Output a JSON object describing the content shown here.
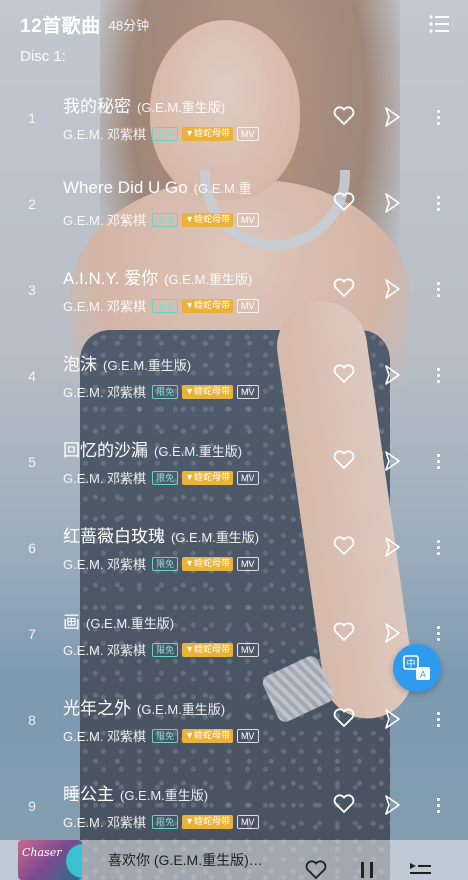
{
  "header": {
    "title": "12首歌曲",
    "duration": "48分钟",
    "menu_icon": "list-menu-icon"
  },
  "disc_label": "Disc 1:",
  "badges": {
    "free": "限免",
    "album": "▼蝰蛇母带",
    "mv": "MV"
  },
  "tracks": [
    {
      "num": "1",
      "name": "我的秘密",
      "version": "(G.E.M.重生版)",
      "artist": "G.E.M. 邓紫棋"
    },
    {
      "num": "2",
      "name": "Where Did U Go",
      "version": "(G.E.M.重",
      "artist": "G.E.M. 邓紫棋"
    },
    {
      "num": "3",
      "name": "A.I.N.Y. 爱你",
      "version": "(G.E.M.重生版)",
      "artist": "G.E.M. 邓紫棋"
    },
    {
      "num": "4",
      "name": "泡沫",
      "version": "(G.E.M.重生版)",
      "artist": "G.E.M. 邓紫棋"
    },
    {
      "num": "5",
      "name": "回忆的沙漏",
      "version": "(G.E.M.重生版)",
      "artist": "G.E.M. 邓紫棋"
    },
    {
      "num": "6",
      "name": "红蔷薇白玫瑰",
      "version": "(G.E.M.重生版)",
      "artist": "G.E.M. 邓紫棋"
    },
    {
      "num": "7",
      "name": "画",
      "version": "(G.E.M.重生版)",
      "artist": "G.E.M. 邓紫棋"
    },
    {
      "num": "8",
      "name": "光年之外",
      "version": "(G.E.M.重生版)",
      "artist": "G.E.M. 邓紫棋"
    },
    {
      "num": "9",
      "name": "睡公主",
      "version": "(G.E.M.重生版)",
      "artist": "G.E.M. 邓紫棋"
    }
  ],
  "float_button": {
    "icon": "translate-icon",
    "glyph_top": "中",
    "glyph_bottom": "A"
  },
  "player": {
    "now_playing": "喜欢你 (G.E.M.重生版)…",
    "cover_text": "Chaser",
    "icons": [
      "heart-icon",
      "pause-icon",
      "queue-icon"
    ]
  },
  "colors": {
    "accent_blue": "#2f9bef",
    "badge_free": "#6ad2c7",
    "badge_album": "#e9b23a"
  }
}
